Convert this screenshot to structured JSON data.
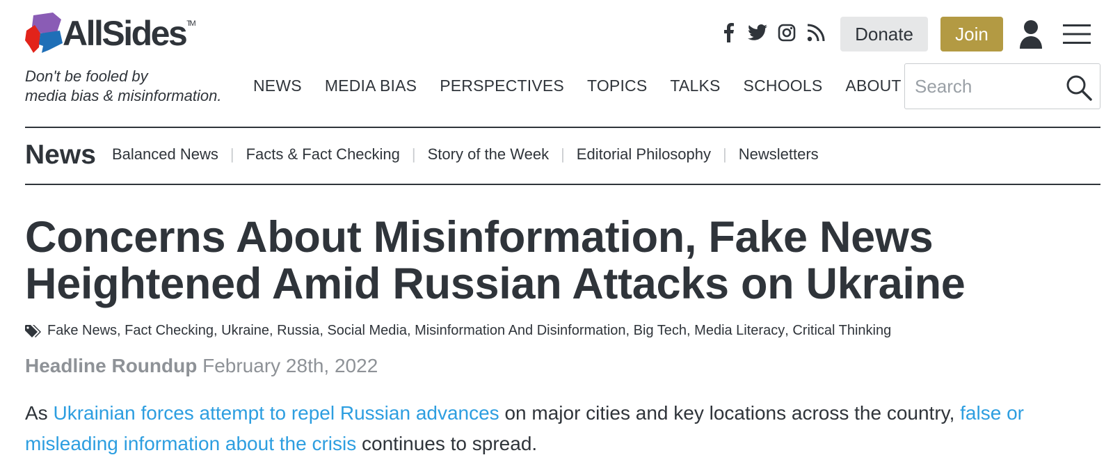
{
  "brand": {
    "name": "AllSides",
    "trademark": "TM",
    "tagline_line1": "Don't be fooled by",
    "tagline_line2": "media bias & misinformation."
  },
  "social": [
    "facebook-icon",
    "twitter-icon",
    "instagram-icon",
    "rss-icon"
  ],
  "actions": {
    "donate_label": "Donate",
    "join_label": "Join"
  },
  "nav": {
    "items": [
      "NEWS",
      "MEDIA BIAS",
      "PERSPECTIVES",
      "TOPICS",
      "TALKS",
      "SCHOOLS",
      "ABOUT"
    ]
  },
  "search": {
    "placeholder": "Search"
  },
  "section": {
    "title": "News",
    "links": [
      "Balanced News",
      "Facts & Fact Checking",
      "Story of the Week",
      "Editorial Philosophy",
      "Newsletters"
    ]
  },
  "article": {
    "headline_line1": "Concerns About Misinformation, Fake News",
    "headline_line2": "Heightened Amid Russian Attacks on Ukraine",
    "tags": [
      "Fake News",
      "Fact Checking",
      "Ukraine",
      "Russia",
      "Social Media",
      "Misinformation And Disinformation",
      "Big Tech",
      "Media Literacy",
      "Critical Thinking"
    ],
    "type": "Headline Roundup",
    "date": "February 28th, 2022",
    "lead": {
      "part1": "As ",
      "link1": "Ukrainian forces attempt to repel Russian advances",
      "part2": " on major cities and key locations across the country, ",
      "link2": "false or misleading information about the crisis",
      "part3": " continues to spread."
    }
  },
  "colors": {
    "text": "#2f343a",
    "link": "#2d9ee0",
    "join": "#b39a43",
    "donate_bg": "#e6e7e8",
    "meta": "#8e9297",
    "logo_red": "#e2231a",
    "logo_purple": "#8a5cb5",
    "logo_blue": "#1f6fb7"
  }
}
